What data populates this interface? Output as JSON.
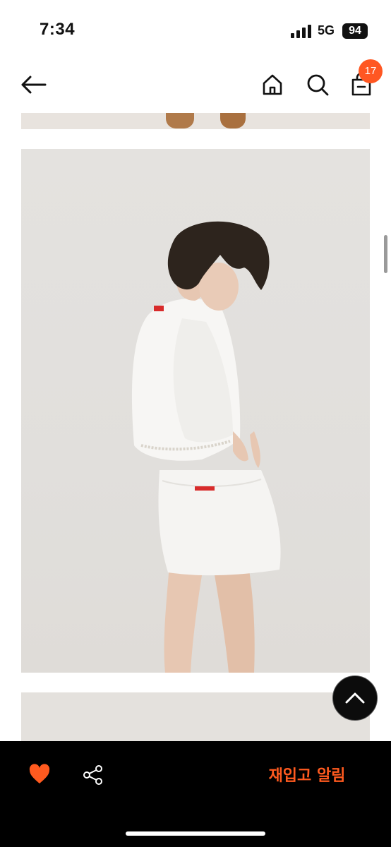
{
  "status_bar": {
    "time": "7:34",
    "network": "5G",
    "battery": "94"
  },
  "header": {
    "back_icon": "arrow-left-icon",
    "home_icon": "home-icon",
    "search_icon": "search-icon",
    "cart_icon": "shopping-bag-icon",
    "cart_count": "17"
  },
  "gallery": {
    "images": [
      {
        "desc_icon": "product-photo-shoes"
      },
      {
        "desc_icon": "product-photo-model-white-outfit"
      },
      {
        "desc_icon": "product-photo-next"
      }
    ]
  },
  "scroll_top": {
    "icon": "chevron-up-icon"
  },
  "bottom_bar": {
    "like_icon": "heart-icon",
    "share_icon": "share-icon",
    "restock_label": "재입고 알림"
  },
  "colors": {
    "accent": "#ff5a1f",
    "badge": "#ff5722",
    "bar_bg": "#000000"
  }
}
